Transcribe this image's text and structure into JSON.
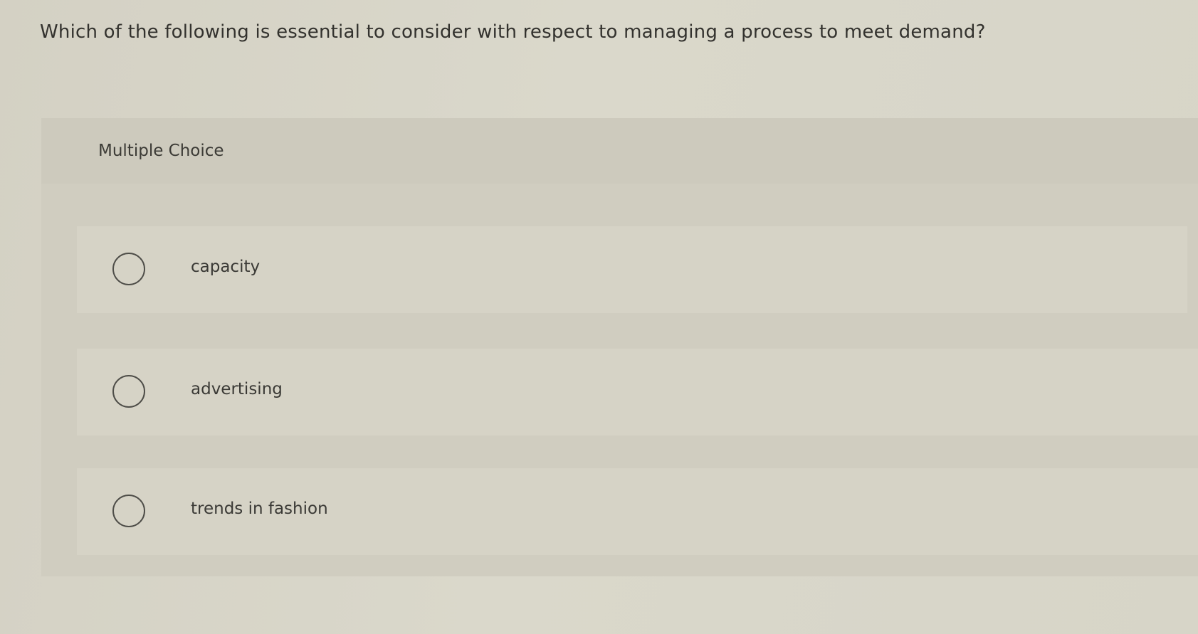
{
  "question": {
    "text": "Which of the following is essential to consider with respect to managing a process to meet demand?"
  },
  "multiple_choice": {
    "title": "Multiple Choice",
    "options": [
      {
        "label": "capacity",
        "selected": false
      },
      {
        "label": "advertising",
        "selected": false
      },
      {
        "label": "trends in fashion",
        "selected": false
      }
    ]
  },
  "icons": {
    "radio": "radio-button-icon"
  }
}
